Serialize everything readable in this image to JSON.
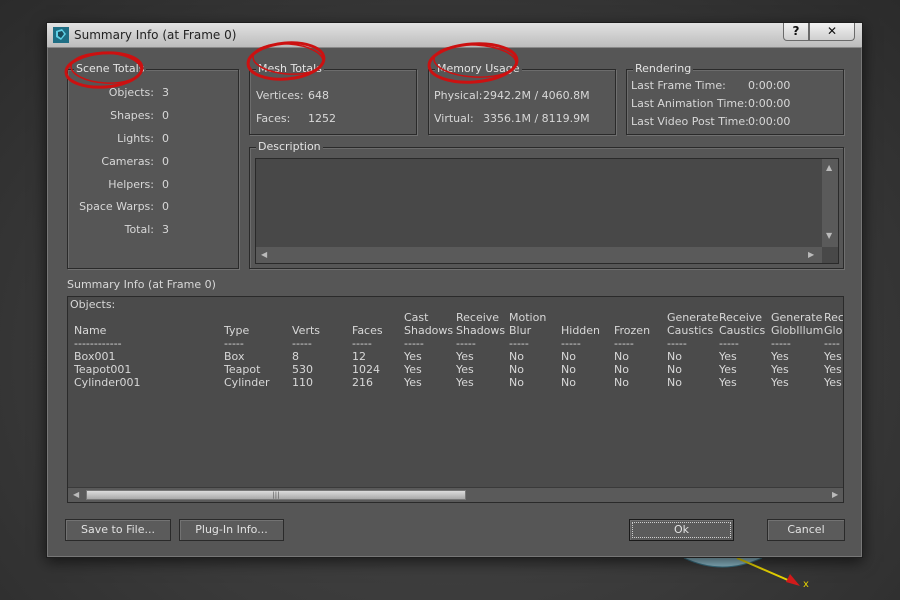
{
  "window": {
    "title": "Summary Info (at Frame 0)",
    "help_label": "?",
    "close_label": "✕"
  },
  "scene_totals": {
    "title": "Scene Totals",
    "rows": [
      {
        "label": "Objects:",
        "value": "3"
      },
      {
        "label": "Shapes:",
        "value": "0"
      },
      {
        "label": "Lights:",
        "value": "0"
      },
      {
        "label": "Cameras:",
        "value": "0"
      },
      {
        "label": "Helpers:",
        "value": "0"
      },
      {
        "label": "Space Warps:",
        "value": "0"
      },
      {
        "label": "Total:",
        "value": "3"
      }
    ]
  },
  "mesh_totals": {
    "title": "Mesh Totals",
    "rows": [
      {
        "label": "Vertices:",
        "value": "648"
      },
      {
        "label": "Faces:",
        "value": "1252"
      }
    ]
  },
  "memory_usage": {
    "title": "Memory Usage",
    "rows": [
      {
        "label": "Physical:",
        "value": "2942.2M / 4060.8M"
      },
      {
        "label": "Virtual:",
        "value": "3356.1M / 8119.9M"
      }
    ]
  },
  "rendering": {
    "title": "Rendering",
    "rows": [
      {
        "label": "Last Frame Time:",
        "value": "0:00:00"
      },
      {
        "label": "Last Animation Time:",
        "value": "0:00:00"
      },
      {
        "label": "Last Video Post Time:",
        "value": "0:00:00"
      }
    ]
  },
  "description": {
    "title": "Description",
    "text": ""
  },
  "report": {
    "section_label": "Summary Info (at Frame 0)",
    "objects_heading": "Objects:",
    "columns": [
      {
        "header": "\nName",
        "sep": "------------",
        "cells": [
          "Box001",
          "Teapot001",
          "Cylinder001"
        ]
      },
      {
        "header": "\nType",
        "sep": "-----",
        "cells": [
          "Box",
          "Teapot",
          "Cylinder"
        ]
      },
      {
        "header": "\nVerts",
        "sep": "-----",
        "cells": [
          "8",
          "530",
          "110"
        ]
      },
      {
        "header": "\nFaces",
        "sep": "-----",
        "cells": [
          "12",
          "1024",
          "216"
        ]
      },
      {
        "header": "Cast\nShadows",
        "sep": "-----",
        "cells": [
          "Yes",
          "Yes",
          "Yes"
        ]
      },
      {
        "header": "Receive\nShadows",
        "sep": "-----",
        "cells": [
          "Yes",
          "Yes",
          "Yes"
        ]
      },
      {
        "header": "Motion\nBlur",
        "sep": "-----",
        "cells": [
          "No",
          "No",
          "No"
        ]
      },
      {
        "header": "\nHidden",
        "sep": "-----",
        "cells": [
          "No",
          "No",
          "No"
        ]
      },
      {
        "header": "\nFrozen",
        "sep": "-----",
        "cells": [
          "No",
          "No",
          "No"
        ]
      },
      {
        "header": "Generate\nCaustics",
        "sep": "-----",
        "cells": [
          "No",
          "No",
          "No"
        ]
      },
      {
        "header": "Receive\nCaustics",
        "sep": "-----",
        "cells": [
          "Yes",
          "Yes",
          "Yes"
        ]
      },
      {
        "header": "Generate\nGlobIllum",
        "sep": "-----",
        "cells": [
          "Yes",
          "Yes",
          "Yes"
        ]
      },
      {
        "header": "Rec\nGlob",
        "sep": "----",
        "cells": [
          "Yes",
          "Yes",
          "Yes"
        ]
      }
    ]
  },
  "buttons": {
    "save": "Save to File...",
    "plugin": "Plug-In Info...",
    "ok": "Ok",
    "cancel": "Cancel"
  },
  "scroll": {
    "thumb_grip": "|||"
  },
  "gizmo": {
    "axis_label": "x"
  },
  "colors": {
    "annotation_red": "#cc1111",
    "dialog_bg": "#565656",
    "titlebar": "#d0d0d0"
  }
}
